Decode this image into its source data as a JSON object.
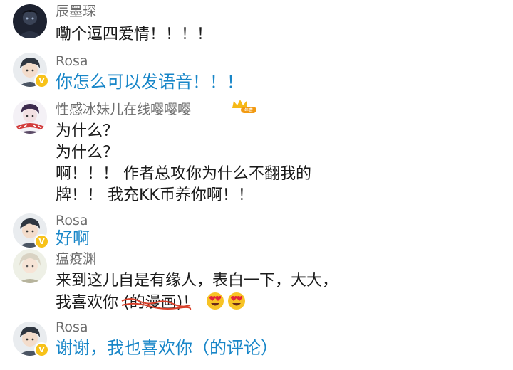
{
  "comments": [
    {
      "username": "辰墨琛",
      "lines": [
        "嘞个逗四爱情！！！！"
      ]
    },
    {
      "username": "Rosa",
      "lines": [
        "你怎么可以发语音！！！"
      ],
      "badge": "V"
    },
    {
      "username": "性感冰妹儿在线嘤嘤嘤",
      "lines": [
        "为什么？",
        "为什么？",
        "啊！！！ 作者总攻你为什么不翻我的",
        "牌！！ 我充KK币养你啊！！"
      ]
    },
    {
      "username": "Rosa",
      "lines": [
        "好啊"
      ],
      "badge": "V"
    },
    {
      "username": "瘟疫渊",
      "lines": [
        "来到这儿自是有缘人，表白一下，大大，"
      ],
      "line2_prefix": "我喜欢你 ",
      "line2_struck": "(的漫画)",
      "line2_suffix": "！",
      "emojis": [
        "heart-eyes-emoji",
        "heart-eyes-emoji"
      ]
    },
    {
      "username": "Rosa",
      "lines": [
        "谢谢，我也喜欢你（的评论）"
      ],
      "badge": "V"
    }
  ],
  "colors": {
    "username": "#6e6e6e",
    "body_text": "#1a1a1a",
    "reply_text": "#1886c8",
    "v_badge": "#f7c21a",
    "strike": "#d9412b"
  }
}
